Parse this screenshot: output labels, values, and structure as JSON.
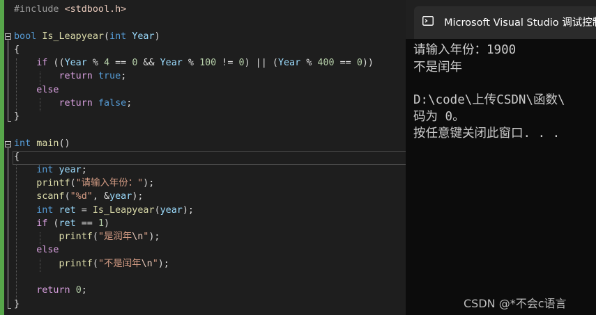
{
  "editor": {
    "include_line_pre": "#include",
    "include_header": "<stdbool.h>",
    "fn_return_type": "bool",
    "fn_name": "Is_Leapyear",
    "fn_param_type": "int",
    "fn_param_name": "Year",
    "open_brace": "{",
    "close_brace": "}",
    "kw_if": "if",
    "kw_else": "else",
    "kw_return": "return",
    "kw_true": "true",
    "kw_false": "false",
    "kw_int": "int",
    "main_name": "main",
    "var_year": "year",
    "var_ret": "ret",
    "fn_printf": "printf",
    "fn_scanf": "scanf",
    "str_prompt": "\"请输入年份：\"",
    "str_fmt": "\"%d\"",
    "str_is_leap_pre": "\"是润年",
    "str_not_leap_pre": "\"不是闰年",
    "esc_newline": "\\n",
    "quote": "\"",
    "num_4": "4",
    "num_0": "0",
    "num_100": "100",
    "num_400": "400",
    "num_1": "1"
  },
  "console": {
    "tab_title": "Microsoft Visual Studio 调试控制台",
    "lines": [
      "请输入年份：1900",
      "不是闰年",
      "",
      "D:\\code\\上传CSDN\\函数\\",
      "码为 0。",
      "按任意键关闭此窗口. . ."
    ]
  },
  "watermark": "CSDN @*不会c语言",
  "colors": {
    "editor_bg": "#1e1e1e",
    "console_bg": "#0c0c0c",
    "change_bar": "#57a64a",
    "keyword": "#569cd6",
    "control": "#d8a0df",
    "function": "#dcdcaa",
    "string": "#d69d85",
    "number": "#b5cea8",
    "variable": "#9cdcfe"
  },
  "icons": [
    "terminal-icon",
    "collapse-region-icon"
  ]
}
